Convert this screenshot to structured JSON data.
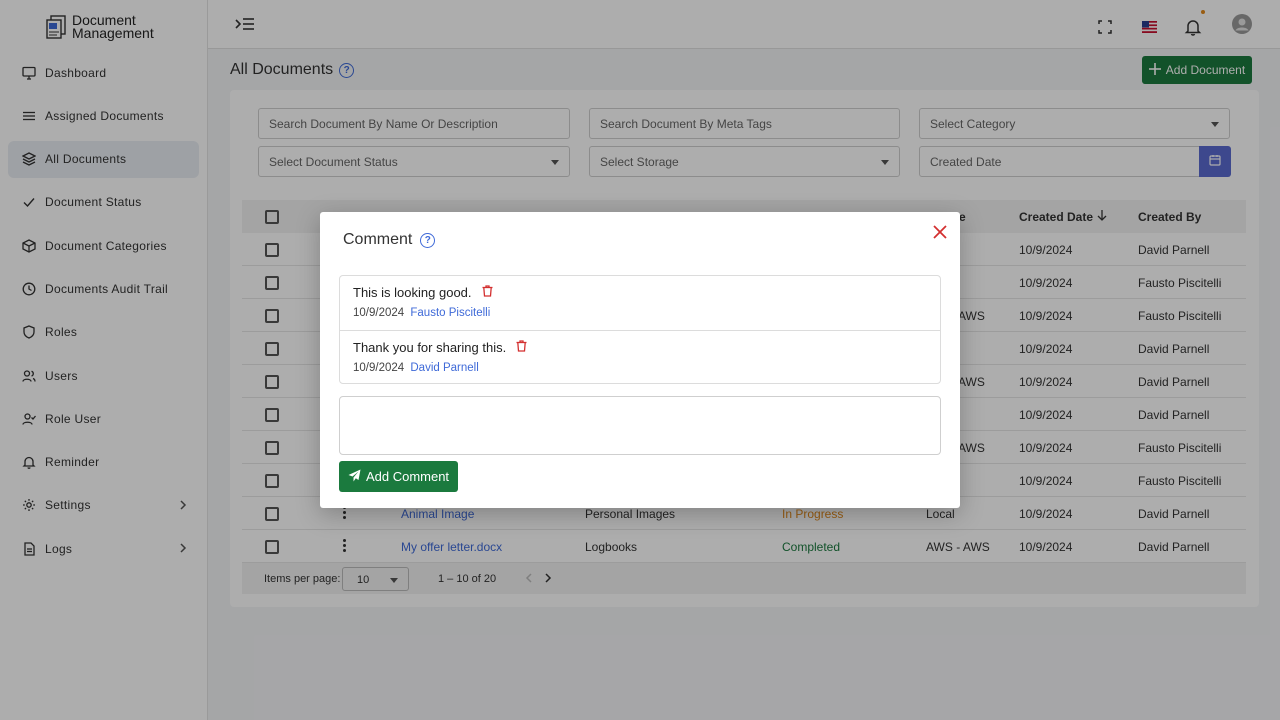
{
  "app": {
    "logo_line1": "Document",
    "logo_line2": "Management"
  },
  "sidebar": {
    "items": [
      {
        "label": "Dashboard",
        "icon": "monitor-icon"
      },
      {
        "label": "Assigned Documents",
        "icon": "list-icon"
      },
      {
        "label": "All Documents",
        "icon": "layers-icon",
        "active": true
      },
      {
        "label": "Document Status",
        "icon": "check-icon"
      },
      {
        "label": "Document Categories",
        "icon": "box-icon"
      },
      {
        "label": "Documents Audit Trail",
        "icon": "clock-icon"
      },
      {
        "label": "Roles",
        "icon": "shield-icon"
      },
      {
        "label": "Users",
        "icon": "users-icon"
      },
      {
        "label": "Role User",
        "icon": "user-check-icon"
      },
      {
        "label": "Reminder",
        "icon": "bell-icon"
      },
      {
        "label": "Settings",
        "icon": "gear-icon",
        "expandable": true
      },
      {
        "label": "Logs",
        "icon": "file-icon",
        "expandable": true
      }
    ]
  },
  "header": {
    "icons": [
      "menu-toggle-icon",
      "fullscreen-icon",
      "us-flag-icon",
      "bell-icon",
      "avatar-icon"
    ]
  },
  "main": {
    "title": "All Documents",
    "add_button_label": "Add Document",
    "filters": {
      "search_name_placeholder": "Search Document By Name Or Description",
      "search_meta_placeholder": "Search Document By Meta Tags",
      "category_placeholder": "Select Category",
      "status_placeholder": "Select Document Status",
      "storage_placeholder": "Select Storage",
      "created_date_placeholder": "Created Date"
    },
    "table": {
      "headers": {
        "storage": "e",
        "created_date": "Created Date",
        "created_by": "Created By"
      },
      "rows": [
        {
          "name": "",
          "category": "",
          "status": "",
          "storage": "",
          "date": "10/9/2024",
          "by": "David Parnell"
        },
        {
          "name": "",
          "category": "",
          "status": "",
          "storage": "",
          "date": "10/9/2024",
          "by": "Fausto Piscitelli"
        },
        {
          "name": "",
          "category": "",
          "status": "",
          "storage": "AWS",
          "date": "10/9/2024",
          "by": "Fausto Piscitelli"
        },
        {
          "name": "",
          "category": "",
          "status": "",
          "storage": "",
          "date": "10/9/2024",
          "by": "David Parnell"
        },
        {
          "name": "",
          "category": "",
          "status": "",
          "storage": "AWS",
          "date": "10/9/2024",
          "by": "David Parnell"
        },
        {
          "name": "",
          "category": "",
          "status": "",
          "storage": "",
          "date": "10/9/2024",
          "by": "David Parnell"
        },
        {
          "name": "",
          "category": "",
          "status": "",
          "storage": "AWS",
          "date": "10/9/2024",
          "by": "Fausto Piscitelli"
        },
        {
          "name": "",
          "category": "",
          "status": "",
          "storage": "",
          "date": "10/9/2024",
          "by": "Fausto Piscitelli"
        },
        {
          "name": "Animal Image",
          "category": "Personal Images",
          "status": "In Progress",
          "storage": "Local",
          "date": "10/9/2024",
          "by": "David Parnell"
        },
        {
          "name": "My offer letter.docx",
          "category": "Logbooks",
          "status": "Completed",
          "storage": "AWS - AWS",
          "date": "10/9/2024",
          "by": "David Parnell"
        }
      ]
    },
    "pager": {
      "items_per_page_label": "Items per page:",
      "page_size": "10",
      "range": "1 – 10 of 20"
    }
  },
  "dialog": {
    "title": "Comment",
    "comments": [
      {
        "text": "This is looking good.",
        "date": "10/9/2024",
        "author": "Fausto Piscitelli"
      },
      {
        "text": "Thank you for sharing this.",
        "date": "10/9/2024",
        "author": "David Parnell"
      }
    ],
    "input_value": "",
    "add_button_label": "Add Comment"
  },
  "colors": {
    "primary_green": "#1b7a3e",
    "link_blue": "#3f6ad8",
    "calendar_button": "#5b6ad0",
    "danger_red": "#d32f2f",
    "status_in_progress": "#e28a1c",
    "status_completed": "#1b7a3e"
  }
}
